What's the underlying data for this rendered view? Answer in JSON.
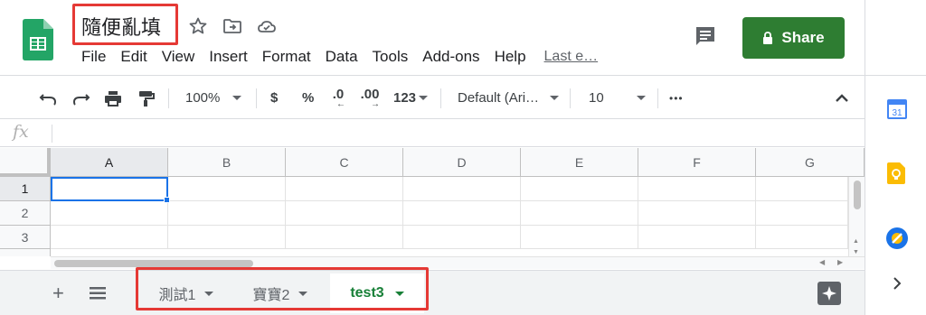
{
  "header": {
    "doc_title": "隨便亂填",
    "menu": [
      "File",
      "Edit",
      "View",
      "Insert",
      "Format",
      "Data",
      "Tools",
      "Add-ons",
      "Help"
    ],
    "last_edit": "Last e…",
    "share_label": "Share"
  },
  "toolbar": {
    "zoom": "100%",
    "currency": "$",
    "percent": "%",
    "decrease_decimal": ".0",
    "increase_decimal": ".00",
    "more_formats": "123",
    "font": "Default (Ari…",
    "font_size": "10",
    "more": "•••"
  },
  "formula_bar": {
    "fx_label": "fx",
    "value": ""
  },
  "grid": {
    "columns": [
      "A",
      "B",
      "C",
      "D",
      "E",
      "F",
      "G"
    ],
    "rows": [
      "1",
      "2",
      "3"
    ],
    "active_cell": "A1"
  },
  "sheets": {
    "tabs": [
      {
        "label": "測試1",
        "active": false
      },
      {
        "label": "寶寶2",
        "active": false
      },
      {
        "label": "test3",
        "active": true
      }
    ]
  },
  "side_panel": {
    "calendar_day": "31",
    "icons": [
      "calendar-icon",
      "keep-icon",
      "tasks-icon",
      "expand-panel-icon"
    ]
  },
  "colors": {
    "share_green": "#2e7d32",
    "active_tab_green": "#188038",
    "highlight_red": "#e53935",
    "selection_blue": "#1a73e8"
  }
}
